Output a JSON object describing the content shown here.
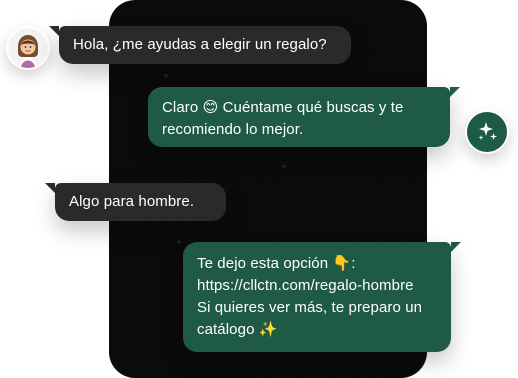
{
  "chat": {
    "messages": [
      {
        "side": "incoming",
        "lines": [
          "Hola, ¿me ayudas a elegir un regalo?"
        ]
      },
      {
        "side": "outgoing",
        "lines": [
          "Claro 😊 Cuéntame qué buscas y te",
          "recomiendo lo mejor."
        ]
      },
      {
        "side": "incoming",
        "lines": [
          "Algo para hombre."
        ]
      },
      {
        "side": "outgoing",
        "lines": [
          "Te dejo esta opción 👇:",
          "https://cllctn.com/regalo-hombre",
          "Si quieres ver más, te preparo un",
          "catálogo ✨"
        ]
      }
    ]
  },
  "icons": {
    "user_avatar": "user-avatar-icon",
    "bot_avatar": "sparkles-icon"
  },
  "colors": {
    "phone_bg": "#0b0b0b",
    "incoming_bubble": "#2a2a2a",
    "outgoing_bubble": "#1f5a46",
    "text": "#ffffff"
  }
}
